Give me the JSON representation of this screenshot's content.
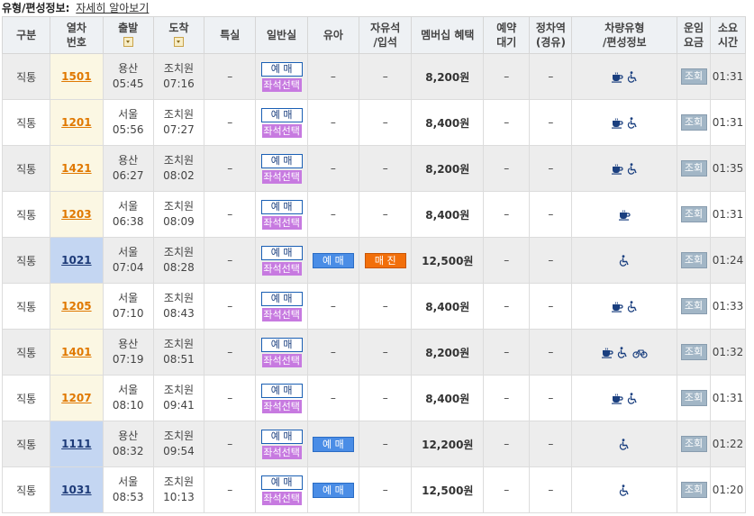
{
  "header": {
    "title": "유형/편성정보:",
    "link": "자세히 알아보기"
  },
  "columns": {
    "type": "구분",
    "train_no_1": "열차",
    "train_no_2": "번호",
    "depart": "출발",
    "arrive": "도착",
    "special": "특실",
    "general": "일반실",
    "infant": "유아",
    "free_1": "자유석",
    "free_2": "/입석",
    "membership": "멤버십 혜택",
    "waiting_1": "예약",
    "waiting_2": "대기",
    "stop_1": "정차역",
    "stop_2": "(경유)",
    "vehicle_1": "차량유형",
    "vehicle_2": "/편성정보",
    "fare_1": "운임",
    "fare_2": "요금",
    "time_1": "소요",
    "time_2": "시간"
  },
  "labels": {
    "dash": "–",
    "reserve": "예 매",
    "seat_select": "좌석선택",
    "infant_reserve": "예 매",
    "sold_out": "매 진",
    "view": "조회"
  },
  "rows": [
    {
      "type": "직통",
      "no": "1501",
      "blue": false,
      "from": "용산",
      "dep": "05:45",
      "to": "조치원",
      "arr": "07:16",
      "infant": false,
      "free": "",
      "fare": "8,200원",
      "icons": [
        "cafe-icon",
        "wheelchair-icon"
      ],
      "dur": "01:31"
    },
    {
      "type": "직통",
      "no": "1201",
      "blue": false,
      "from": "서울",
      "dep": "05:56",
      "to": "조치원",
      "arr": "07:27",
      "infant": false,
      "free": "",
      "fare": "8,400원",
      "icons": [
        "cafe-icon",
        "wheelchair-icon"
      ],
      "dur": "01:31"
    },
    {
      "type": "직통",
      "no": "1421",
      "blue": false,
      "from": "용산",
      "dep": "06:27",
      "to": "조치원",
      "arr": "08:02",
      "infant": false,
      "free": "",
      "fare": "8,200원",
      "icons": [
        "cafe-icon",
        "wheelchair-icon"
      ],
      "dur": "01:35"
    },
    {
      "type": "직통",
      "no": "1203",
      "blue": false,
      "from": "서울",
      "dep": "06:38",
      "to": "조치원",
      "arr": "08:09",
      "infant": false,
      "free": "",
      "fare": "8,400원",
      "icons": [
        "cafe-icon"
      ],
      "dur": "01:31"
    },
    {
      "type": "직통",
      "no": "1021",
      "blue": true,
      "from": "서울",
      "dep": "07:04",
      "to": "조치원",
      "arr": "08:28",
      "infant": true,
      "free": "sold",
      "fare": "12,500원",
      "icons": [
        "wheelchair-icon"
      ],
      "dur": "01:24"
    },
    {
      "type": "직통",
      "no": "1205",
      "blue": false,
      "from": "서울",
      "dep": "07:10",
      "to": "조치원",
      "arr": "08:43",
      "infant": false,
      "free": "",
      "fare": "8,400원",
      "icons": [
        "cafe-icon",
        "wheelchair-icon"
      ],
      "dur": "01:33"
    },
    {
      "type": "직통",
      "no": "1401",
      "blue": false,
      "from": "용산",
      "dep": "07:19",
      "to": "조치원",
      "arr": "08:51",
      "infant": false,
      "free": "",
      "fare": "8,200원",
      "icons": [
        "cafe-icon",
        "wheelchair-icon",
        "bicycle-icon"
      ],
      "dur": "01:32"
    },
    {
      "type": "직통",
      "no": "1207",
      "blue": false,
      "from": "서울",
      "dep": "08:10",
      "to": "조치원",
      "arr": "09:41",
      "infant": false,
      "free": "",
      "fare": "8,400원",
      "icons": [
        "cafe-icon",
        "wheelchair-icon"
      ],
      "dur": "01:31"
    },
    {
      "type": "직통",
      "no": "1111",
      "blue": true,
      "from": "용산",
      "dep": "08:32",
      "to": "조치원",
      "arr": "09:54",
      "infant": true,
      "free": "",
      "fare": "12,200원",
      "icons": [
        "wheelchair-icon"
      ],
      "dur": "01:22"
    },
    {
      "type": "직통",
      "no": "1031",
      "blue": true,
      "from": "서울",
      "dep": "08:53",
      "to": "조치원",
      "arr": "10:13",
      "infant": true,
      "free": "",
      "fare": "12,500원",
      "icons": [
        "wheelchair-icon"
      ],
      "dur": "01:20"
    }
  ]
}
